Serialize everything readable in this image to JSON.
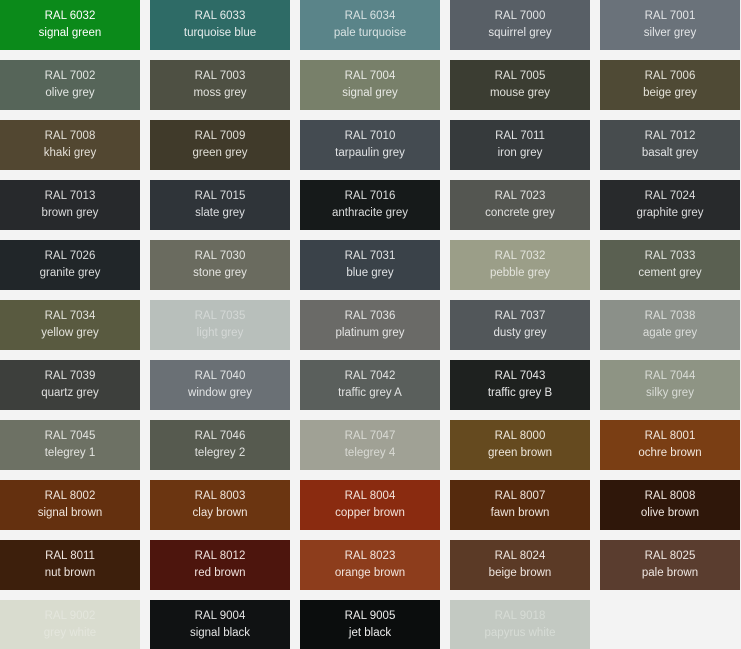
{
  "swatches": [
    {
      "code": "RAL 6032",
      "name": "signal green",
      "color": "#0b8a1a",
      "text_color": "#ffffff"
    },
    {
      "code": "RAL 6033",
      "name": "turquoise blue",
      "color": "#2e6b66",
      "text_color": "#e6ecec"
    },
    {
      "code": "RAL 6034",
      "name": "pale turquoise",
      "color": "#5a8489",
      "text_color": "#d8e2e3"
    },
    {
      "code": "RAL 7000",
      "name": "squirrel grey",
      "color": "#585f66",
      "text_color": "#e3e5e7"
    },
    {
      "code": "RAL 7001",
      "name": "silver grey",
      "color": "#6a727a",
      "text_color": "#e3e5e7"
    },
    {
      "code": "RAL 7002",
      "name": "olive grey",
      "color": "#566559",
      "text_color": "#e3e6e3"
    },
    {
      "code": "RAL 7003",
      "name": "moss grey",
      "color": "#4e5043",
      "text_color": "#e3e3de"
    },
    {
      "code": "RAL 7004",
      "name": "signal grey",
      "color": "#78806a",
      "text_color": "#e8e9e4"
    },
    {
      "code": "RAL 7005",
      "name": "mouse grey",
      "color": "#3b3d32",
      "text_color": "#e0e0da"
    },
    {
      "code": "RAL 7006",
      "name": "beige grey",
      "color": "#4f4a35",
      "text_color": "#e4e2d8"
    },
    {
      "code": "RAL 7008",
      "name": "khaki grey",
      "color": "#524731",
      "text_color": "#e4e0d8"
    },
    {
      "code": "RAL 7009",
      "name": "green grey",
      "color": "#403a2a",
      "text_color": "#e0ded6"
    },
    {
      "code": "RAL 7010",
      "name": "tarpaulin grey",
      "color": "#444b51",
      "text_color": "#e1e3e5"
    },
    {
      "code": "RAL 7011",
      "name": "iron grey",
      "color": "#363a3c",
      "text_color": "#dfe0e1"
    },
    {
      "code": "RAL 7012",
      "name": "basalt grey",
      "color": "#474c4e",
      "text_color": "#e1e2e3"
    },
    {
      "code": "RAL 7013",
      "name": "brown grey",
      "color": "#27292c",
      "text_color": "#dcdcdd"
    },
    {
      "code": "RAL 7015",
      "name": "slate grey",
      "color": "#2f3439",
      "text_color": "#dcdee0"
    },
    {
      "code": "RAL 7016",
      "name": "anthracite grey",
      "color": "#161a1a",
      "text_color": "#dcdddd"
    },
    {
      "code": "RAL 7023",
      "name": "concrete grey",
      "color": "#545651",
      "text_color": "#e2e2e0"
    },
    {
      "code": "RAL 7024",
      "name": "graphite grey",
      "color": "#282a2c",
      "text_color": "#dcdcdd"
    },
    {
      "code": "RAL 7026",
      "name": "granite grey",
      "color": "#212629",
      "text_color": "#dcdddd"
    },
    {
      "code": "RAL 7030",
      "name": "stone grey",
      "color": "#6a6b5f",
      "text_color": "#e4e4e0"
    },
    {
      "code": "RAL 7031",
      "name": "blue grey",
      "color": "#3a4249",
      "text_color": "#e0e2e4"
    },
    {
      "code": "RAL 7032",
      "name": "pebble grey",
      "color": "#9b9e88",
      "text_color": "#e3e4dc"
    },
    {
      "code": "RAL 7033",
      "name": "cement grey",
      "color": "#5a6051",
      "text_color": "#e2e4df"
    },
    {
      "code": "RAL 7034",
      "name": "yellow grey",
      "color": "#595a40",
      "text_color": "#e4e4dc"
    },
    {
      "code": "RAL 7035",
      "name": "light grey",
      "color": "#b8bfbb",
      "text_color": "#d4d8d6"
    },
    {
      "code": "RAL 7036",
      "name": "platinum grey",
      "color": "#6a6a67",
      "text_color": "#e4e4e3"
    },
    {
      "code": "RAL 7037",
      "name": "dusty grey",
      "color": "#52575a",
      "text_color": "#e2e3e4"
    },
    {
      "code": "RAL 7038",
      "name": "agate grey",
      "color": "#8b9089",
      "text_color": "#dcdedb"
    },
    {
      "code": "RAL 7039",
      "name": "quartz grey",
      "color": "#3d3f3c",
      "text_color": "#e0e0df"
    },
    {
      "code": "RAL 7040",
      "name": "window grey",
      "color": "#6a7075",
      "text_color": "#e2e4e5"
    },
    {
      "code": "RAL 7042",
      "name": "traffic grey A",
      "color": "#5a5f5c",
      "text_color": "#e2e3e2"
    },
    {
      "code": "RAL 7043",
      "name": "traffic grey B",
      "color": "#1e211f",
      "text_color": "#e6e6e6"
    },
    {
      "code": "RAL 7044",
      "name": "silky grey",
      "color": "#8e9484",
      "text_color": "#d9dcd6"
    },
    {
      "code": "RAL 7045",
      "name": "telegrey 1",
      "color": "#6d7164",
      "text_color": "#e4e5e1"
    },
    {
      "code": "RAL 7046",
      "name": "telegrey 2",
      "color": "#565a4f",
      "text_color": "#e2e3e0"
    },
    {
      "code": "RAL 7047",
      "name": "telegrey 4",
      "color": "#a0a195",
      "text_color": "#d9dad4"
    },
    {
      "code": "RAL 8000",
      "name": "green brown",
      "color": "#654a1f",
      "text_color": "#efe8dc"
    },
    {
      "code": "RAL 8001",
      "name": "ochre brown",
      "color": "#7a3e14",
      "text_color": "#f1e6dc"
    },
    {
      "code": "RAL 8002",
      "name": "signal brown",
      "color": "#64300f",
      "text_color": "#f0e5dc"
    },
    {
      "code": "RAL 8003",
      "name": "clay brown",
      "color": "#6b3511",
      "text_color": "#f0e5dc"
    },
    {
      "code": "RAL 8004",
      "name": "copper brown",
      "color": "#8a2b10",
      "text_color": "#f3e4dc"
    },
    {
      "code": "RAL 8007",
      "name": "fawn brown",
      "color": "#552a0d",
      "text_color": "#efe4dc"
    },
    {
      "code": "RAL 8008",
      "name": "olive brown",
      "color": "#2f170a",
      "text_color": "#eee6e0"
    },
    {
      "code": "RAL 8011",
      "name": "nut brown",
      "color": "#3d1f0c",
      "text_color": "#eee5df"
    },
    {
      "code": "RAL 8012",
      "name": "red brown",
      "color": "#4d150d",
      "text_color": "#f0e2de"
    },
    {
      "code": "RAL 8023",
      "name": "orange brown",
      "color": "#8d3d1c",
      "text_color": "#f3e6df"
    },
    {
      "code": "RAL 8024",
      "name": "beige brown",
      "color": "#5b3a26",
      "text_color": "#efe6e0"
    },
    {
      "code": "RAL 8025",
      "name": "pale brown",
      "color": "#5a3d2f",
      "text_color": "#efe7e2"
    },
    {
      "code": "RAL 9002",
      "name": "grey white",
      "color": "#d9dccf",
      "text_color": "#e4e6dd"
    },
    {
      "code": "RAL 9004",
      "name": "signal black",
      "color": "#101213",
      "text_color": "#e4e5e5"
    },
    {
      "code": "RAL 9005",
      "name": "jet black",
      "color": "#0b0d0d",
      "text_color": "#ededed"
    },
    {
      "code": "RAL 9018",
      "name": "papyrus white",
      "color": "#c3c9c2",
      "text_color": "#d7dcd6"
    }
  ]
}
